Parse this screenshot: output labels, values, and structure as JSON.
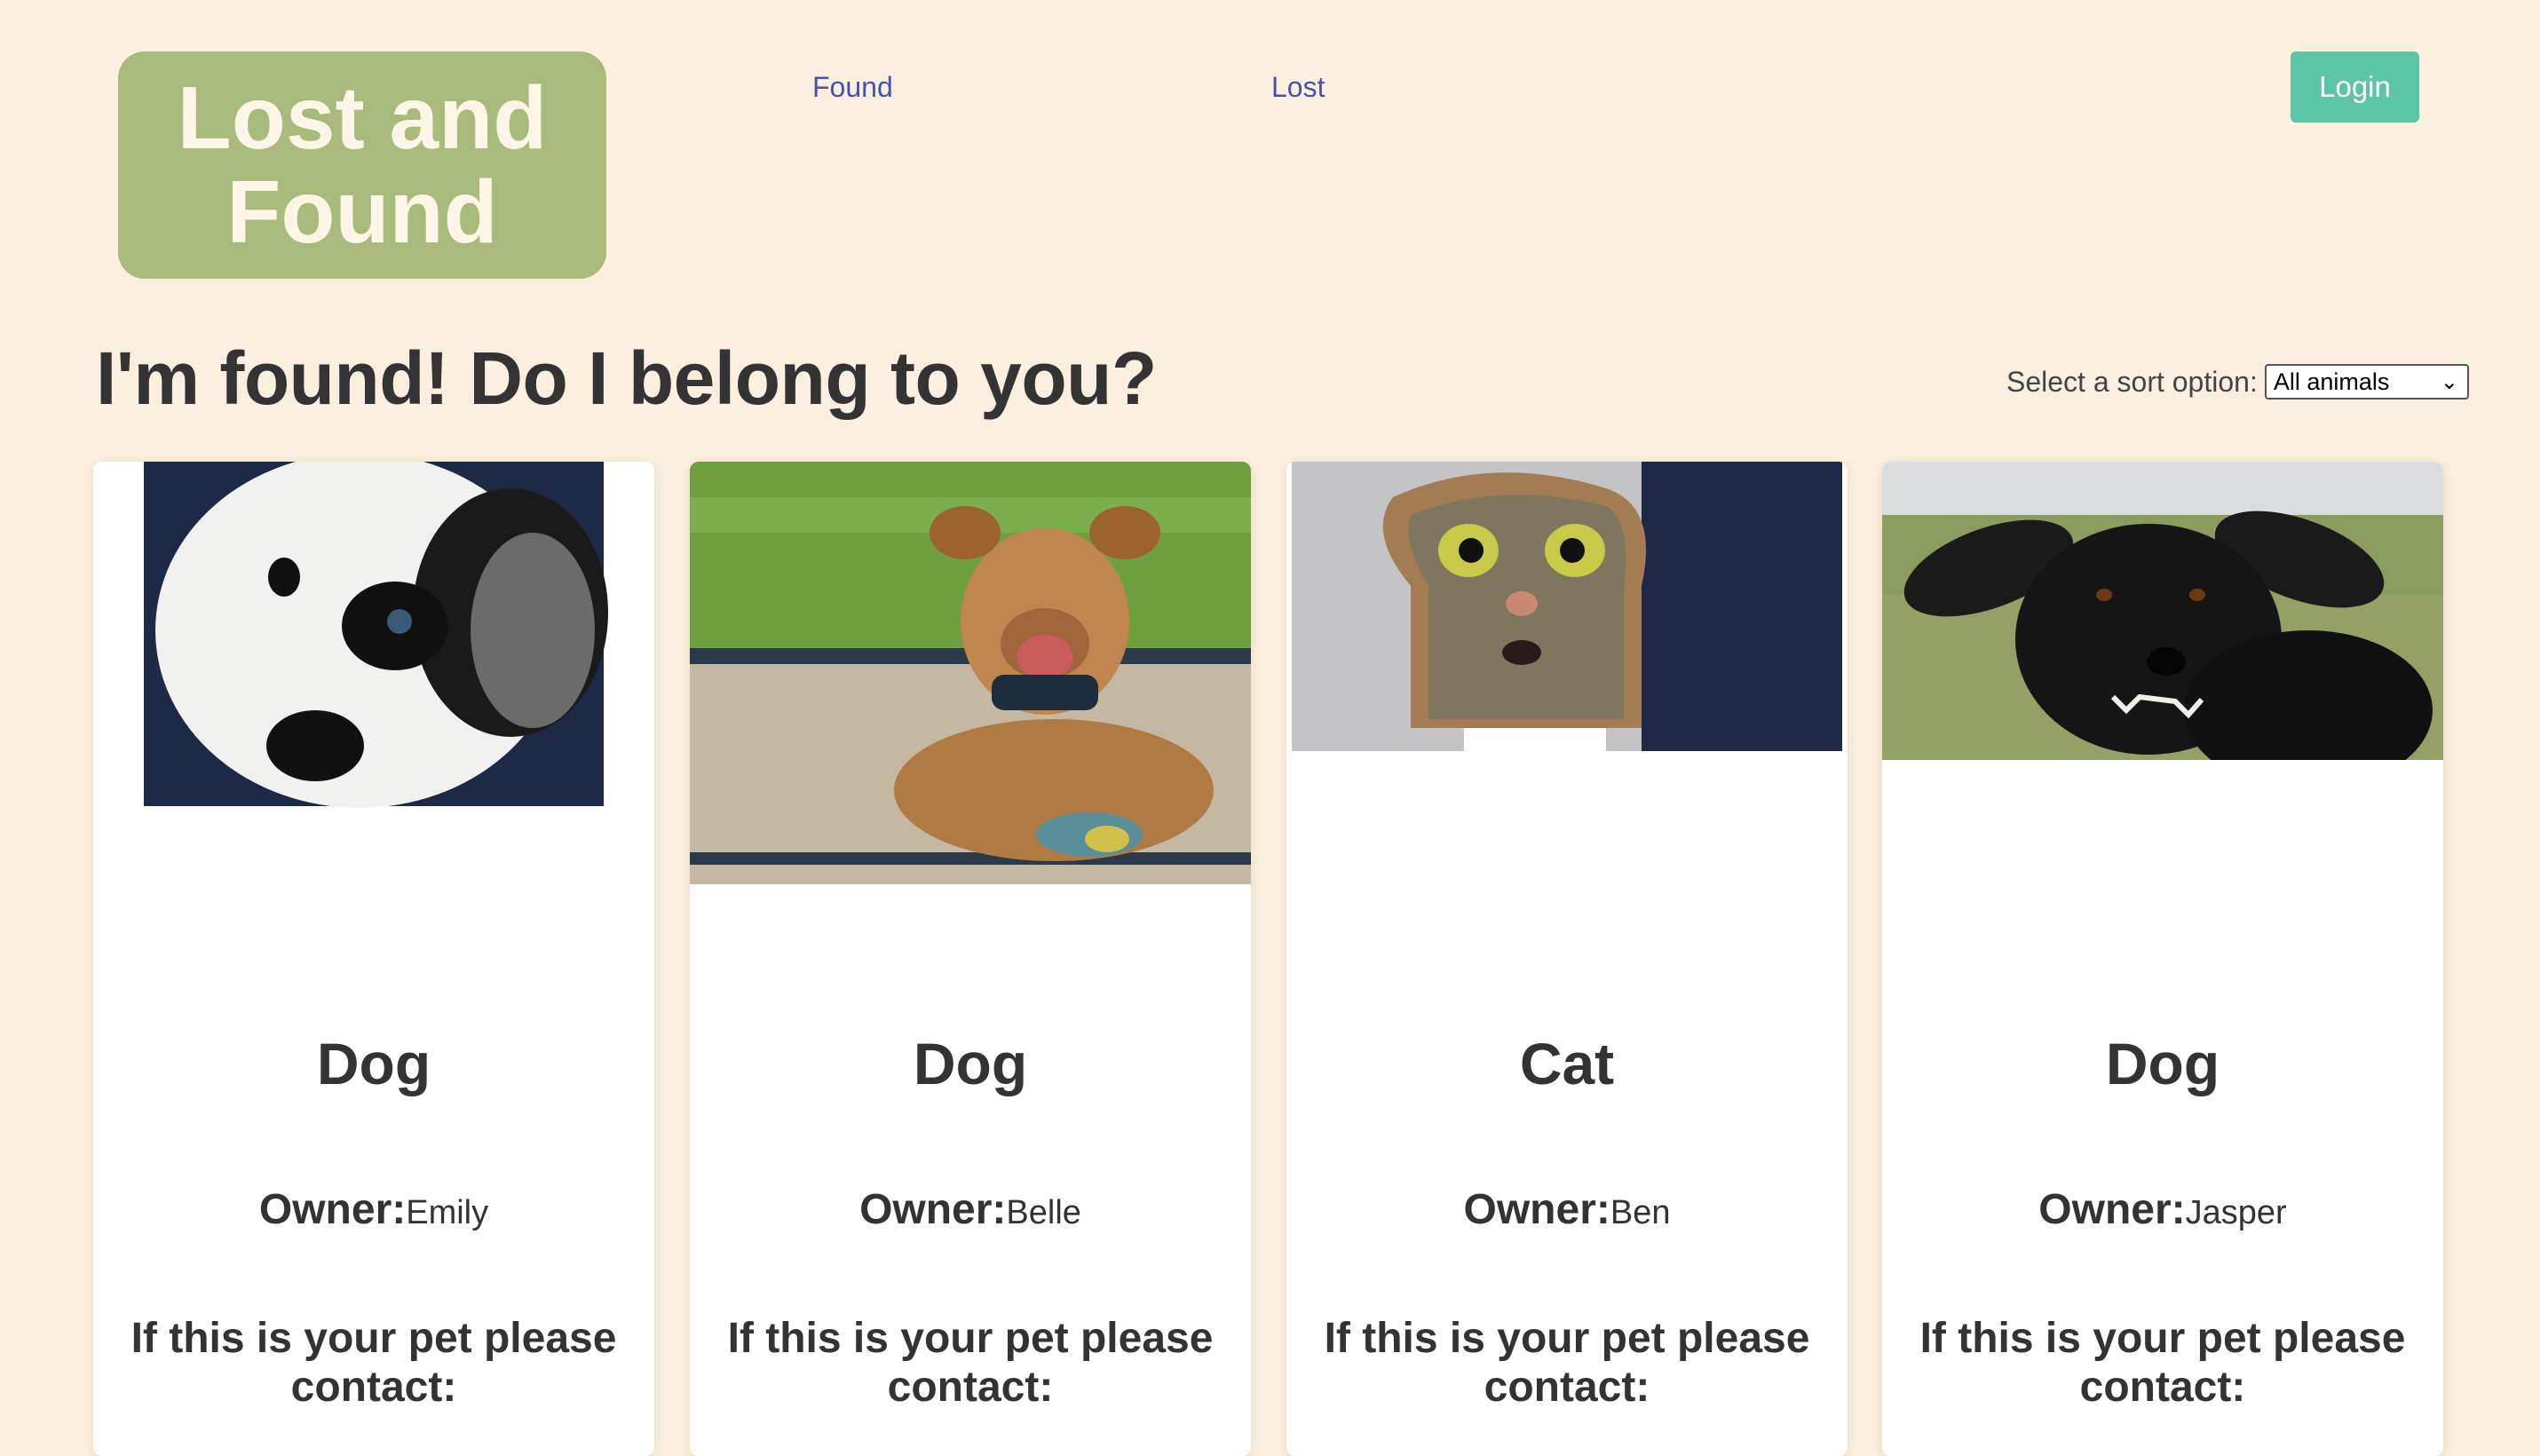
{
  "header": {
    "logo_line1": "Lost and",
    "logo_line2": "Found",
    "nav": [
      {
        "label": "Found"
      },
      {
        "label": "Lost"
      }
    ],
    "login_label": "Login"
  },
  "main": {
    "title": "I'm found! Do I belong to you?",
    "sort": {
      "label": "Select a sort option:",
      "selected": "All animals"
    }
  },
  "cards": [
    {
      "species": "Dog",
      "owner_label": "Owner:",
      "owner": "Emily",
      "contact": "If this is your pet please contact:",
      "photo": "black-and-white-dog-photo"
    },
    {
      "species": "Dog",
      "owner_label": "Owner:",
      "owner": "Belle",
      "contact": "If this is your pet please contact:",
      "photo": "brown-dog-on-sand-photo"
    },
    {
      "species": "Cat",
      "owner_label": "Owner:",
      "owner": "Ben",
      "contact": "If this is your pet please contact:",
      "photo": "cat-in-bread-photo"
    },
    {
      "species": "Dog",
      "owner_label": "Owner:",
      "owner": "Jasper",
      "contact": "If this is your pet please contact:",
      "photo": "black-dog-growling-photo"
    }
  ],
  "colors": {
    "background": "#fbf0df",
    "logo_bg": "#a9bb7c",
    "nav_link": "#4753a9",
    "login_bg": "#5bc5a4"
  }
}
